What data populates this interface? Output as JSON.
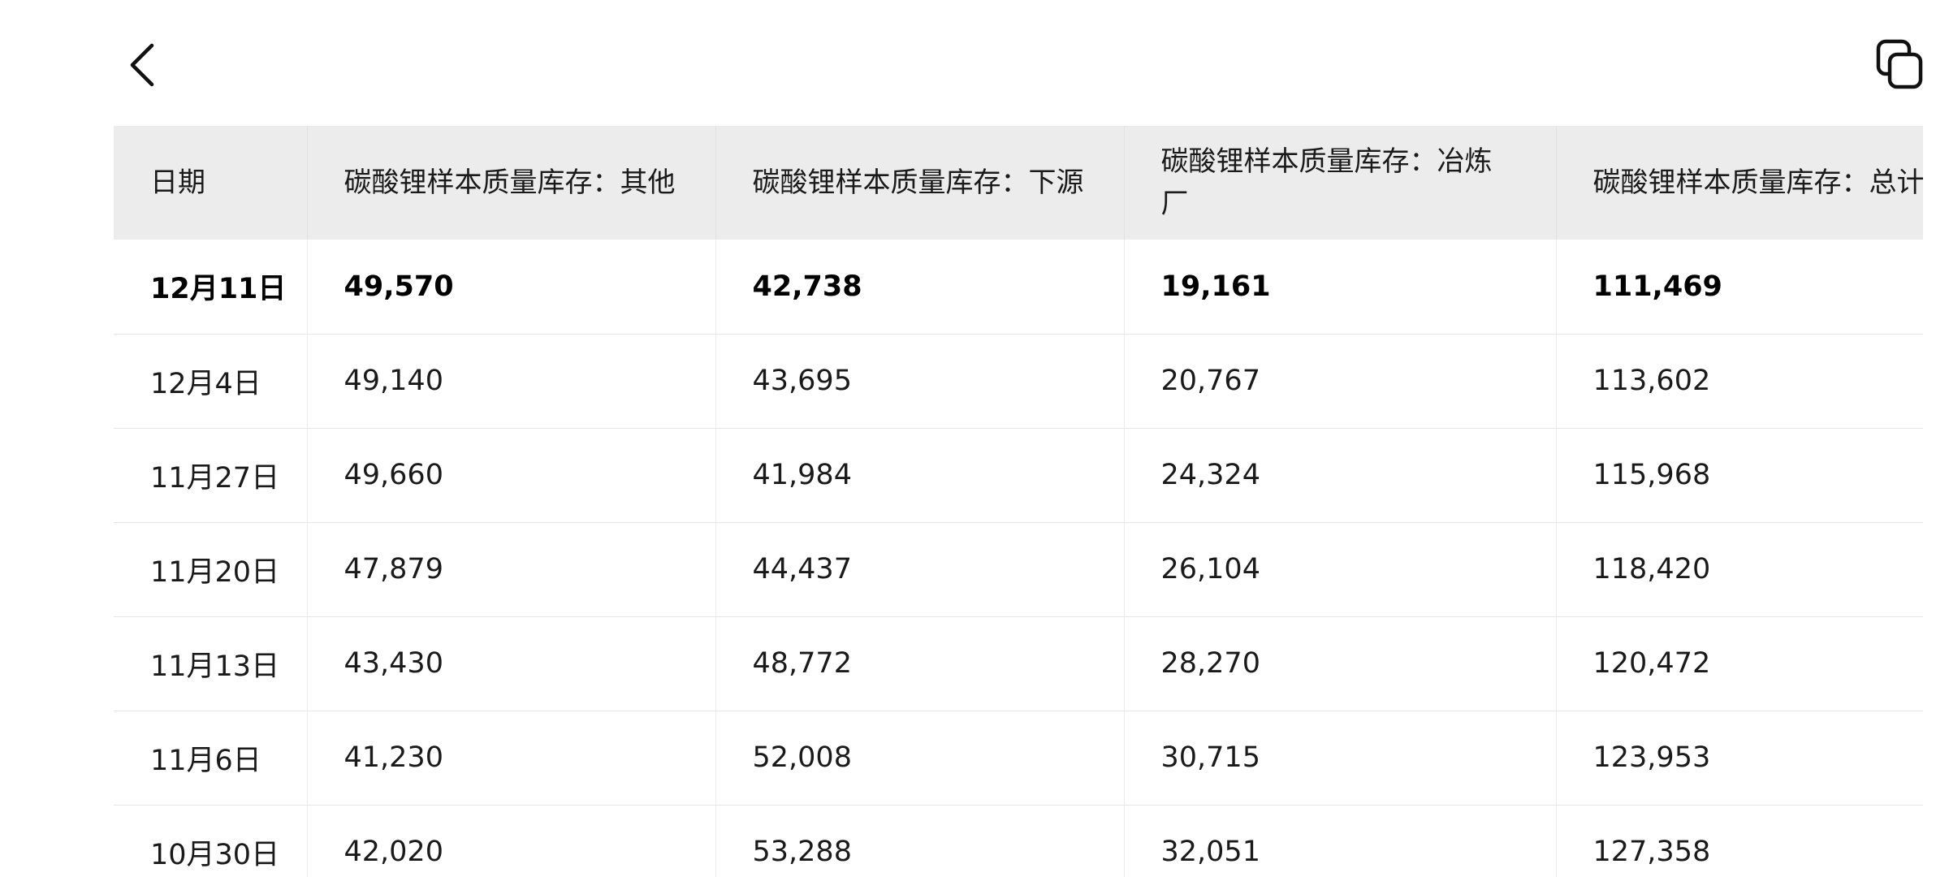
{
  "toolbar": {
    "back_icon": "chevron-left-icon",
    "copy_icon": "copy-icon"
  },
  "table": {
    "headers": [
      "日期",
      "碳酸锂样本质量库存：其他",
      "碳酸锂样本质量库存：下源",
      "碳酸锂样本质量库存：冶炼厂",
      "碳酸锂样本质量库存：总计"
    ],
    "rows": [
      [
        "12月11日",
        "49,570",
        "42,738",
        "19,161",
        "111,469"
      ],
      [
        "12月4日",
        "49,140",
        "43,695",
        "20,767",
        "113,602"
      ],
      [
        "11月27日",
        "49,660",
        "41,984",
        "24,324",
        "115,968"
      ],
      [
        "11月20日",
        "47,879",
        "44,437",
        "26,104",
        "118,420"
      ],
      [
        "11月13日",
        "43,430",
        "48,772",
        "28,270",
        "120,472"
      ],
      [
        "11月6日",
        "41,230",
        "52,008",
        "30,715",
        "123,953"
      ],
      [
        "10月30日",
        "42,020",
        "53,288",
        "32,051",
        "127,358"
      ]
    ]
  },
  "colors": {
    "header_bg": "#ececec",
    "text": "#1a1a1a",
    "border": "#e6e6e6"
  }
}
